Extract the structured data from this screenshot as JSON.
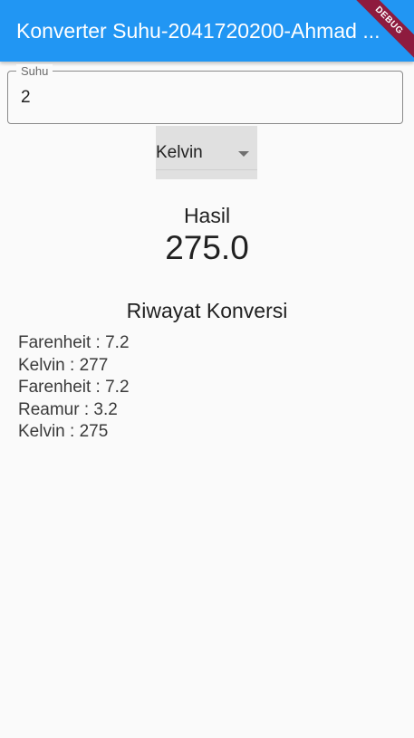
{
  "app_bar": {
    "title": "Konverter Suhu-2041720200-Ahmad ...",
    "debug_label": "DEBUG"
  },
  "input": {
    "label": "Suhu",
    "value": "2"
  },
  "dropdown": {
    "selected": "Kelvin"
  },
  "result": {
    "label": "Hasil",
    "value": "275.0"
  },
  "history": {
    "title": "Riwayat Konversi",
    "items": [
      "Farenheit : 7.2",
      "Kelvin : 277",
      "Farenheit : 7.2",
      "Reamur : 3.2",
      "Kelvin : 275"
    ]
  },
  "colors": {
    "app_bar": "#2196f3",
    "debug_banner": "#8e1b3e",
    "background": "#fafafa"
  },
  "icons": {
    "dropdown": "arrow-drop-down-icon"
  }
}
